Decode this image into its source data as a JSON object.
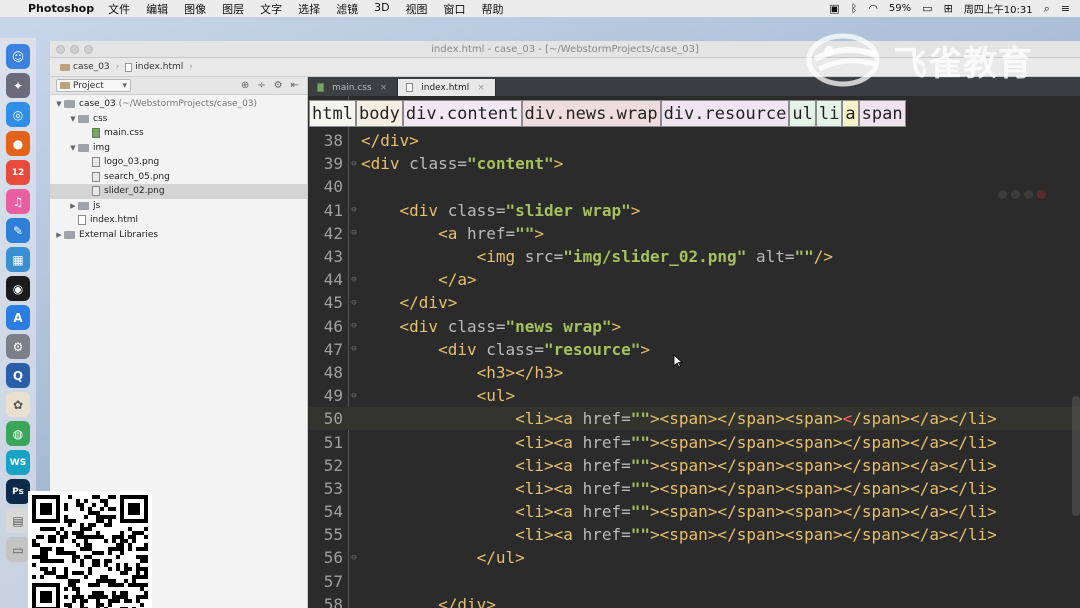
{
  "menubar": {
    "app_name": "Photoshop",
    "items": [
      "文件",
      "编辑",
      "图像",
      "图层",
      "文字",
      "选择",
      "滤镜",
      "3D",
      "视图",
      "窗口",
      "帮助"
    ],
    "battery": "59%",
    "datetime": "周四上午10:31"
  },
  "window": {
    "title": "index.html - case_03 - [~/WebstormProjects/case_03]",
    "nav": [
      "case_03",
      "index.html"
    ]
  },
  "project_panel": {
    "selector": "Project",
    "tree": [
      {
        "label": "case_03",
        "suffix": "(~/WebstormProjects/case_03)",
        "kind": "folder",
        "depth": 0,
        "open": true
      },
      {
        "label": "css",
        "kind": "folder",
        "depth": 1,
        "open": true
      },
      {
        "label": "main.css",
        "kind": "css",
        "depth": 2
      },
      {
        "label": "img",
        "kind": "folder",
        "depth": 1,
        "open": true
      },
      {
        "label": "logo_03.png",
        "kind": "img",
        "depth": 2
      },
      {
        "label": "search_05.png",
        "kind": "img",
        "depth": 2
      },
      {
        "label": "slider_02.png",
        "kind": "img",
        "depth": 2,
        "selected": true
      },
      {
        "label": "js",
        "kind": "folder",
        "depth": 1
      },
      {
        "label": "index.html",
        "kind": "html",
        "depth": 1
      },
      {
        "label": "External Libraries",
        "kind": "lib",
        "depth": 0
      }
    ]
  },
  "editor": {
    "tabs": [
      {
        "label": "main.css",
        "active": false
      },
      {
        "label": "index.html",
        "active": true
      }
    ],
    "breadcrumb": [
      "html",
      "body",
      "div.content",
      "div.news.wrap",
      "div.resource",
      "ul",
      "li",
      "a",
      "span"
    ],
    "lines": [
      {
        "num": "38",
        "indent": 0,
        "html": [
          [
            "t-tag",
            "</div>"
          ]
        ]
      },
      {
        "num": "39",
        "indent": 0,
        "html": [
          [
            "t-tag",
            "<div "
          ],
          [
            "t-attr",
            "class="
          ],
          [
            "t-val",
            "\"content\""
          ],
          [
            "t-tag",
            ">"
          ]
        ]
      },
      {
        "num": "40",
        "indent": 0,
        "html": []
      },
      {
        "num": "41",
        "indent": 4,
        "html": [
          [
            "t-tag",
            "<div "
          ],
          [
            "t-attr",
            "class="
          ],
          [
            "t-val",
            "\"slider wrap\""
          ],
          [
            "t-tag",
            ">"
          ]
        ]
      },
      {
        "num": "42",
        "indent": 8,
        "html": [
          [
            "t-tag",
            "<a "
          ],
          [
            "t-attr",
            "href="
          ],
          [
            "t-val",
            "\"\""
          ],
          [
            "t-tag",
            ">"
          ]
        ]
      },
      {
        "num": "43",
        "indent": 12,
        "html": [
          [
            "t-tag",
            "<img "
          ],
          [
            "t-attr",
            "src="
          ],
          [
            "t-val",
            "\"img/slider_02.png\""
          ],
          [
            "t-attr",
            " alt="
          ],
          [
            "t-val",
            "\"\""
          ],
          [
            "t-tag",
            "/>"
          ]
        ]
      },
      {
        "num": "44",
        "indent": 8,
        "html": [
          [
            "t-tag",
            "</a>"
          ]
        ]
      },
      {
        "num": "45",
        "indent": 4,
        "html": [
          [
            "t-tag",
            "</div>"
          ]
        ]
      },
      {
        "num": "46",
        "indent": 4,
        "html": [
          [
            "t-tag",
            "<div "
          ],
          [
            "t-attr",
            "class="
          ],
          [
            "t-val",
            "\"news wrap\""
          ],
          [
            "t-tag",
            ">"
          ]
        ]
      },
      {
        "num": "47",
        "indent": 8,
        "html": [
          [
            "t-tag",
            "<div "
          ],
          [
            "t-attr",
            "class="
          ],
          [
            "t-val",
            "\"resource\""
          ],
          [
            "t-tag",
            ">"
          ]
        ]
      },
      {
        "num": "48",
        "indent": 12,
        "html": [
          [
            "t-tag",
            "<h3></h3>"
          ]
        ]
      },
      {
        "num": "49",
        "indent": 12,
        "html": [
          [
            "t-tag",
            "<ul>"
          ]
        ]
      },
      {
        "num": "50",
        "indent": 16,
        "current": true,
        "html": [
          [
            "t-tag",
            "<li><a "
          ],
          [
            "t-attr",
            "href="
          ],
          [
            "t-val",
            "\"\""
          ],
          [
            "t-tag",
            "><span></span><span>"
          ],
          [
            "t-cursor",
            "<"
          ],
          [
            "t-tag",
            "/span></a></li>"
          ]
        ]
      },
      {
        "num": "51",
        "indent": 16,
        "html": [
          [
            "t-tag",
            "<li><a "
          ],
          [
            "t-attr",
            "href="
          ],
          [
            "t-val",
            "\"\""
          ],
          [
            "t-tag",
            "><span></span><span></span></a></li>"
          ]
        ]
      },
      {
        "num": "52",
        "indent": 16,
        "html": [
          [
            "t-tag",
            "<li><a "
          ],
          [
            "t-attr",
            "href="
          ],
          [
            "t-val",
            "\"\""
          ],
          [
            "t-tag",
            "><span></span><span></span></a></li>"
          ]
        ]
      },
      {
        "num": "53",
        "indent": 16,
        "html": [
          [
            "t-tag",
            "<li><a "
          ],
          [
            "t-attr",
            "href="
          ],
          [
            "t-val",
            "\"\""
          ],
          [
            "t-tag",
            "><span></span><span></span></a></li>"
          ]
        ]
      },
      {
        "num": "54",
        "indent": 16,
        "html": [
          [
            "t-tag",
            "<li><a "
          ],
          [
            "t-attr",
            "href="
          ],
          [
            "t-val",
            "\"\""
          ],
          [
            "t-tag",
            "><span></span><span></span></a></li>"
          ]
        ]
      },
      {
        "num": "55",
        "indent": 16,
        "html": [
          [
            "t-tag",
            "<li><a "
          ],
          [
            "t-attr",
            "href="
          ],
          [
            "t-val",
            "\"\""
          ],
          [
            "t-tag",
            "><span></span><span></span></a></li>"
          ]
        ]
      },
      {
        "num": "56",
        "indent": 12,
        "html": [
          [
            "t-tag",
            "</ul>"
          ]
        ]
      },
      {
        "num": "57",
        "indent": 0,
        "html": []
      },
      {
        "num": "58",
        "indent": 8,
        "html": [
          [
            "t-tag",
            "</div>"
          ]
        ]
      }
    ]
  },
  "watermark": {
    "text": "飞雀教育"
  },
  "dock": {
    "icons": [
      {
        "name": "finder-icon",
        "color": "#3b82e0",
        "glyph": "☺"
      },
      {
        "name": "launchpad-icon",
        "color": "#6b6b7a",
        "glyph": "✦"
      },
      {
        "name": "safari-icon",
        "color": "#2f8fe8",
        "glyph": "◎"
      },
      {
        "name": "firefox-icon",
        "color": "#e4631b",
        "glyph": "●"
      },
      {
        "name": "calendar-icon",
        "color": "#e84b3c",
        "glyph": "12"
      },
      {
        "name": "itunes-icon",
        "color": "#e85fa1",
        "glyph": "♫"
      },
      {
        "name": "xcode-icon",
        "color": "#2d7fd8",
        "glyph": "✎"
      },
      {
        "name": "preview-icon",
        "color": "#3a8fd0",
        "glyph": "▦"
      },
      {
        "name": "qq-icon",
        "color": "#1b1b1b",
        "glyph": "◉"
      },
      {
        "name": "appstore-icon",
        "color": "#2a7de1",
        "glyph": "A"
      },
      {
        "name": "system-preferences-icon",
        "color": "#7b7f88",
        "glyph": "⚙"
      },
      {
        "name": "quicktime-icon",
        "color": "#2a5ea8",
        "glyph": "Q"
      },
      {
        "name": "photos-icon",
        "color": "#e9e0d0",
        "glyph": "✿"
      },
      {
        "name": "chrome-icon",
        "color": "#3aa65a",
        "glyph": "◍"
      },
      {
        "name": "webstorm-icon",
        "color": "#18a3c4",
        "glyph": "WS"
      },
      {
        "name": "photoshop-icon",
        "color": "#0b2a4a",
        "glyph": "Ps"
      },
      {
        "name": "document-icon",
        "color": "#d9d9d9",
        "glyph": "▤"
      },
      {
        "name": "finder-window-icon",
        "color": "#c4c4c4",
        "glyph": "▭"
      }
    ]
  }
}
